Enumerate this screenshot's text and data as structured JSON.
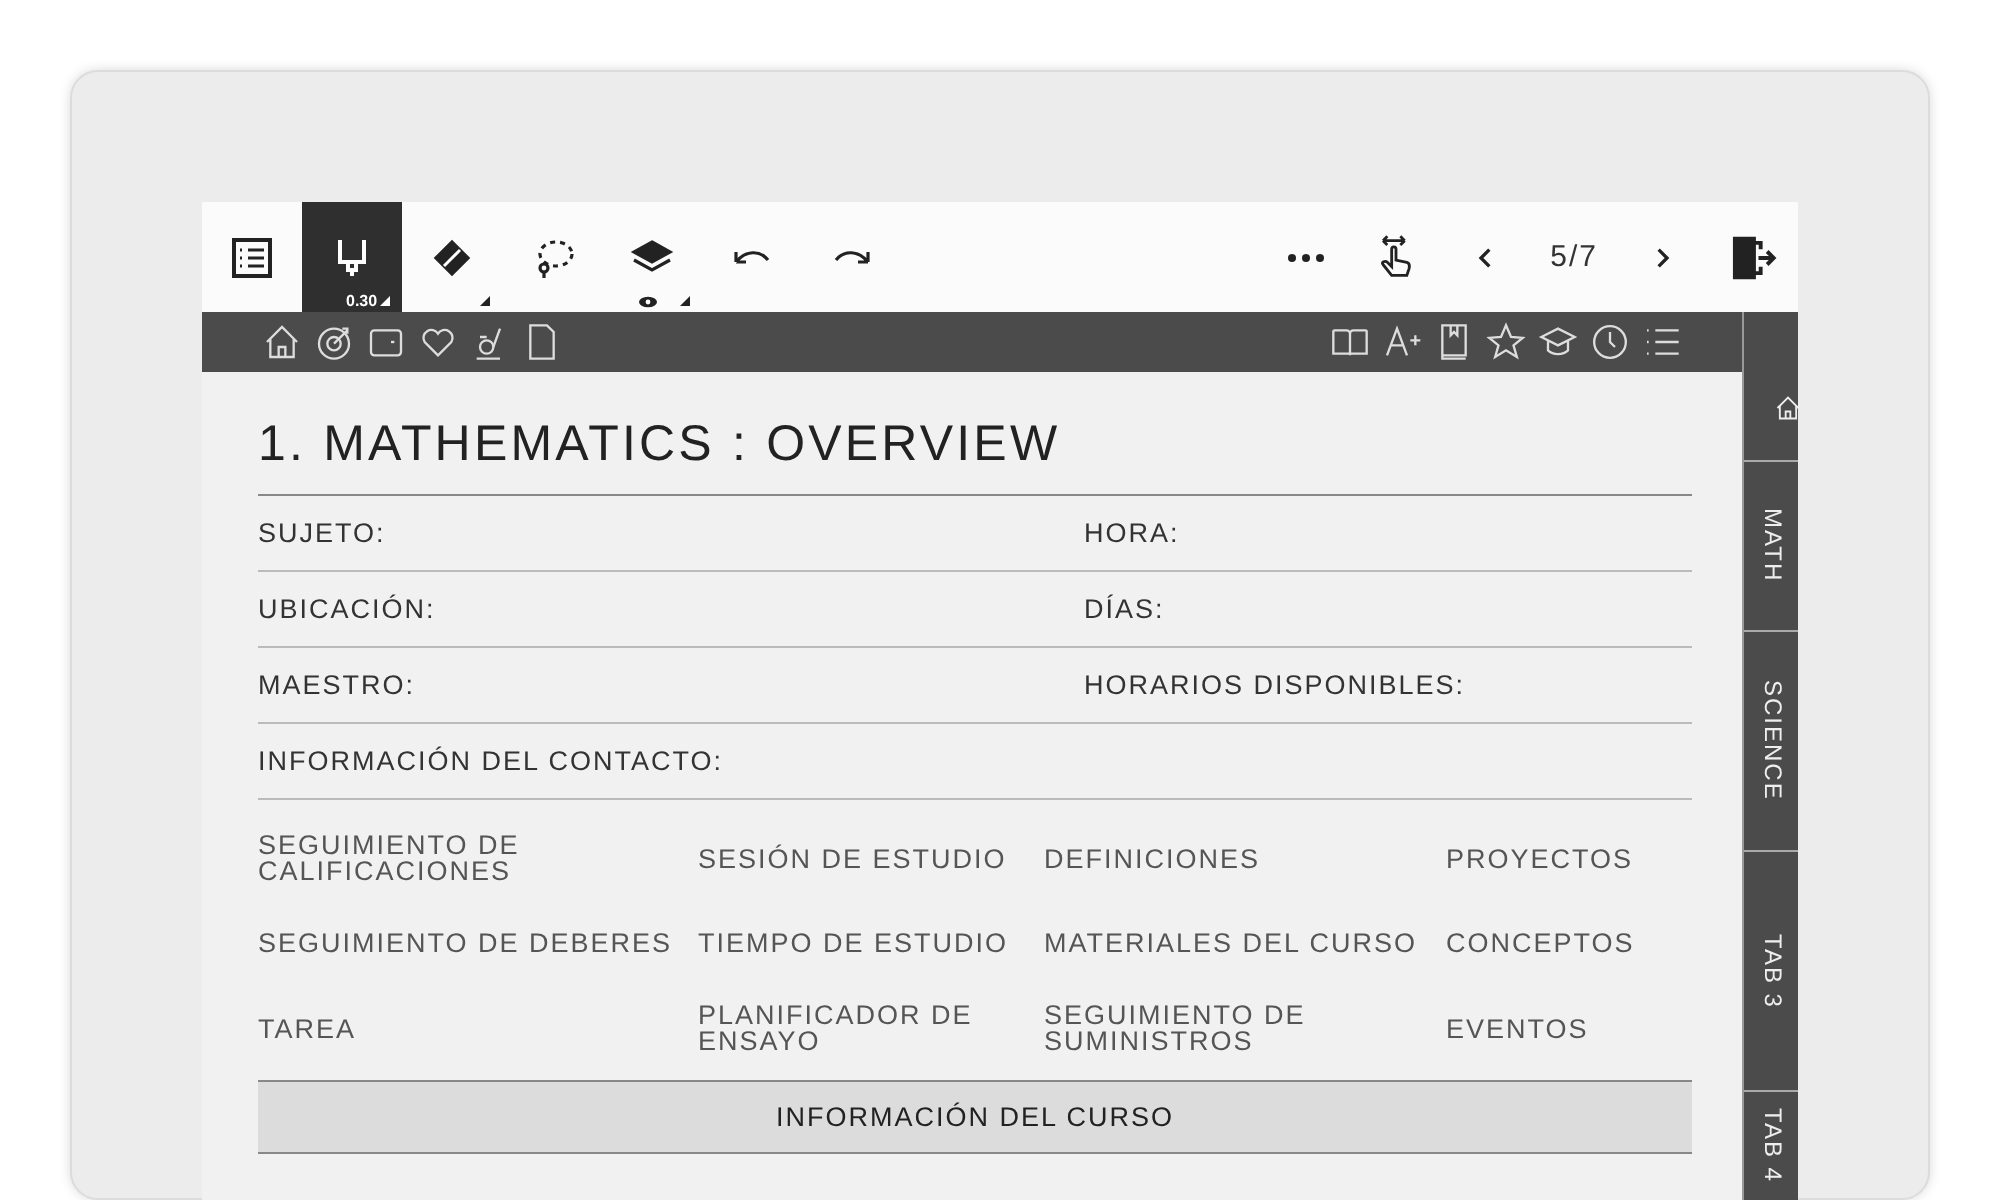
{
  "toolbar": {
    "tools": [
      {
        "kind": "toc",
        "selected": false
      },
      {
        "kind": "pen",
        "selected": true,
        "size": "0.30"
      },
      {
        "kind": "eraser",
        "selected": false
      },
      {
        "kind": "lasso",
        "selected": false
      },
      {
        "kind": "layers",
        "selected": false
      },
      {
        "kind": "undo",
        "selected": false
      },
      {
        "kind": "redo",
        "selected": false
      }
    ],
    "page_indicator": "5/7"
  },
  "side_tabs": [
    {
      "kind": "home",
      "selected": false
    },
    {
      "kind": "text",
      "label": "MATH",
      "selected": false
    },
    {
      "kind": "text",
      "label": "SCIENCE",
      "selected": false
    },
    {
      "kind": "text",
      "label": "TAB 3",
      "selected": false
    },
    {
      "kind": "text",
      "label": "TAB 4",
      "selected": false
    }
  ],
  "page": {
    "title": "1. MATHEMATICS : OVERVIEW",
    "info_rows": [
      {
        "left": "SUJETO:",
        "right": "HORA:"
      },
      {
        "left": "UBICACIÓN:",
        "right": "DÍAS:"
      },
      {
        "left": "MAESTRO:",
        "right": "HORARIOS DISPONIBLES:"
      },
      {
        "left": "INFORMACIÓN DEL CONTACTO:"
      }
    ],
    "links": [
      "SEGUIMIENTO DE CALIFICACIONES",
      "SESIÓN DE ESTUDIO",
      "DEFINICIONES",
      "PROYECTOS",
      "SEGUIMIENTO DE DEBERES",
      "TIEMPO DE ESTUDIO",
      "MATERIALES DEL CURSO",
      "CONCEPTOS",
      "TAREA",
      "PLANIFICADOR DE ENSAYO",
      "SEGUIMIENTO DE SUMINISTROS",
      "EVENTOS"
    ],
    "section_header": "INFORMACIÓN DEL CURSO"
  }
}
